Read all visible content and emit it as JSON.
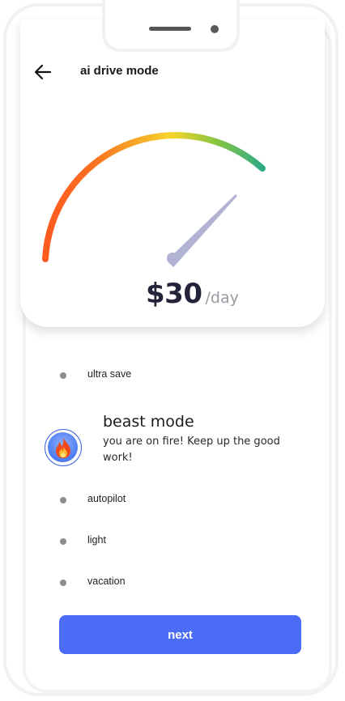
{
  "header": {
    "title": "ai drive mode",
    "back_icon": "arrow-left-icon"
  },
  "gauge": {
    "amount": "$30",
    "unit": "/day",
    "level": 0.8,
    "gradient_colors": [
      "#ff5a1f",
      "#f5c426",
      "#2daa86"
    ],
    "needle_color": "#b1b3d3"
  },
  "modes": {
    "ultra_save": "ultra save",
    "active": {
      "title": "beast mode",
      "description": "you are on fire! Keep up the good work!",
      "icon": "fire-icon"
    },
    "autopilot": "autopilot",
    "light": "light",
    "vacation": "vacation"
  },
  "actions": {
    "next_label": "next"
  },
  "colors": {
    "accent": "#4a6cf7",
    "inactive_dot": "#8d8d8d"
  }
}
